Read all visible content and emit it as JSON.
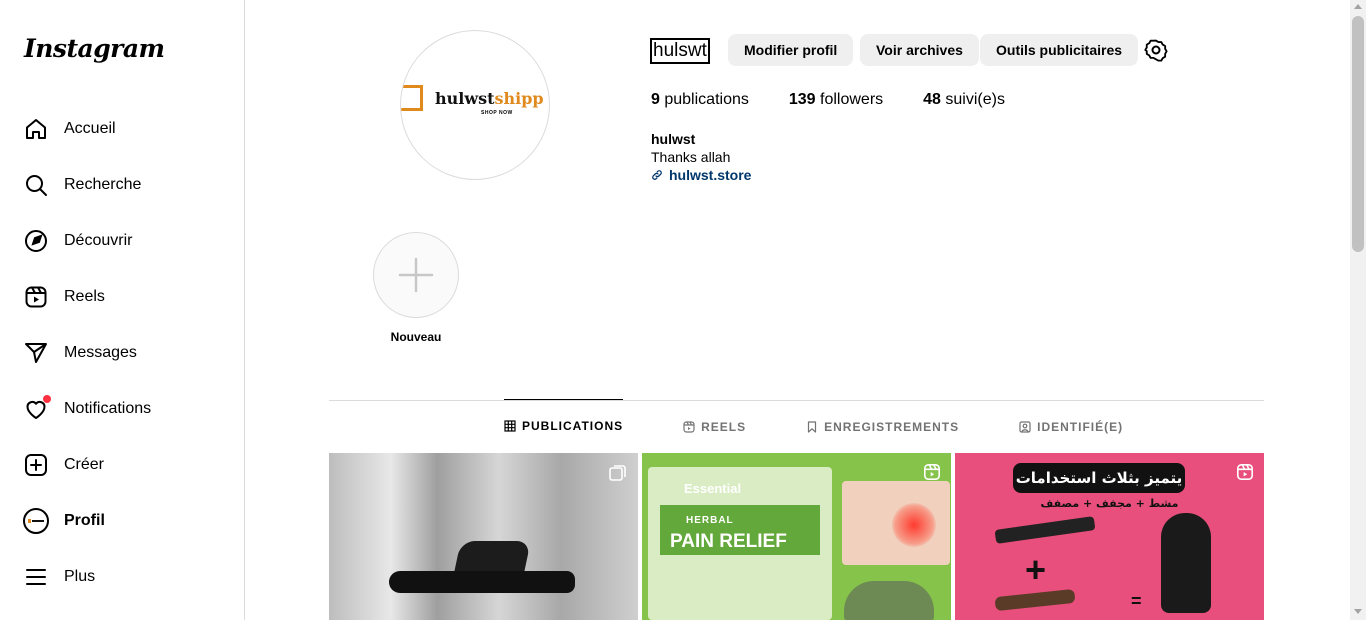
{
  "sidebar": {
    "logo": "Instagram",
    "items": [
      {
        "label": "Accueil",
        "icon": "home-icon"
      },
      {
        "label": "Recherche",
        "icon": "search-icon"
      },
      {
        "label": "Découvrir",
        "icon": "compass-icon"
      },
      {
        "label": "Reels",
        "icon": "reels-icon"
      },
      {
        "label": "Messages",
        "icon": "send-icon"
      },
      {
        "label": "Notifications",
        "icon": "heart-icon"
      },
      {
        "label": "Créer",
        "icon": "plus-square-icon"
      },
      {
        "label": "Profil",
        "icon": "avatar"
      },
      {
        "label": "Plus",
        "icon": "menu-icon"
      }
    ]
  },
  "profile": {
    "username": "hulswt",
    "picture_brand": "hulwst",
    "picture_brand_accent": "shipp",
    "picture_tagline": "SHOP NOW",
    "buttons": {
      "edit": "Modifier profil",
      "archive": "Voir archives",
      "ads": "Outils publicitaires"
    },
    "stats": {
      "posts_count": "9",
      "posts_label": "publications",
      "followers_count": "139",
      "followers_label": "followers",
      "following_count": "48",
      "following_label": "suivi(e)s"
    },
    "bio": {
      "name": "hulwst",
      "text": "Thanks allah",
      "link": "hulwst.store"
    }
  },
  "highlights": {
    "new_label": "Nouveau"
  },
  "tabs": [
    {
      "label": "PUBLICATIONS",
      "icon": "grid-icon",
      "active": true
    },
    {
      "label": "REELS",
      "icon": "reels-icon",
      "active": false
    },
    {
      "label": "ENREGISTREMENTS",
      "icon": "bookmark-icon",
      "active": false
    },
    {
      "label": "IDENTIFIÉ(E)",
      "icon": "tag-icon",
      "active": false
    }
  ],
  "posts": [
    {
      "type": "carousel",
      "icon": "carousel-icon"
    },
    {
      "type": "reel",
      "icon": "reels-icon",
      "brand": "Essential",
      "line1": "HERBAL",
      "line2": "PAIN RELIEF"
    },
    {
      "type": "reel",
      "icon": "reels-icon",
      "title": "يتميز بثلاث استخدامات",
      "subtitle": "مشط + مجفف + مصفف"
    }
  ],
  "colors": {
    "link": "#00376b",
    "notification_dot": "#ff3040",
    "button_bg": "#efefef",
    "border": "#dbdbdb"
  }
}
